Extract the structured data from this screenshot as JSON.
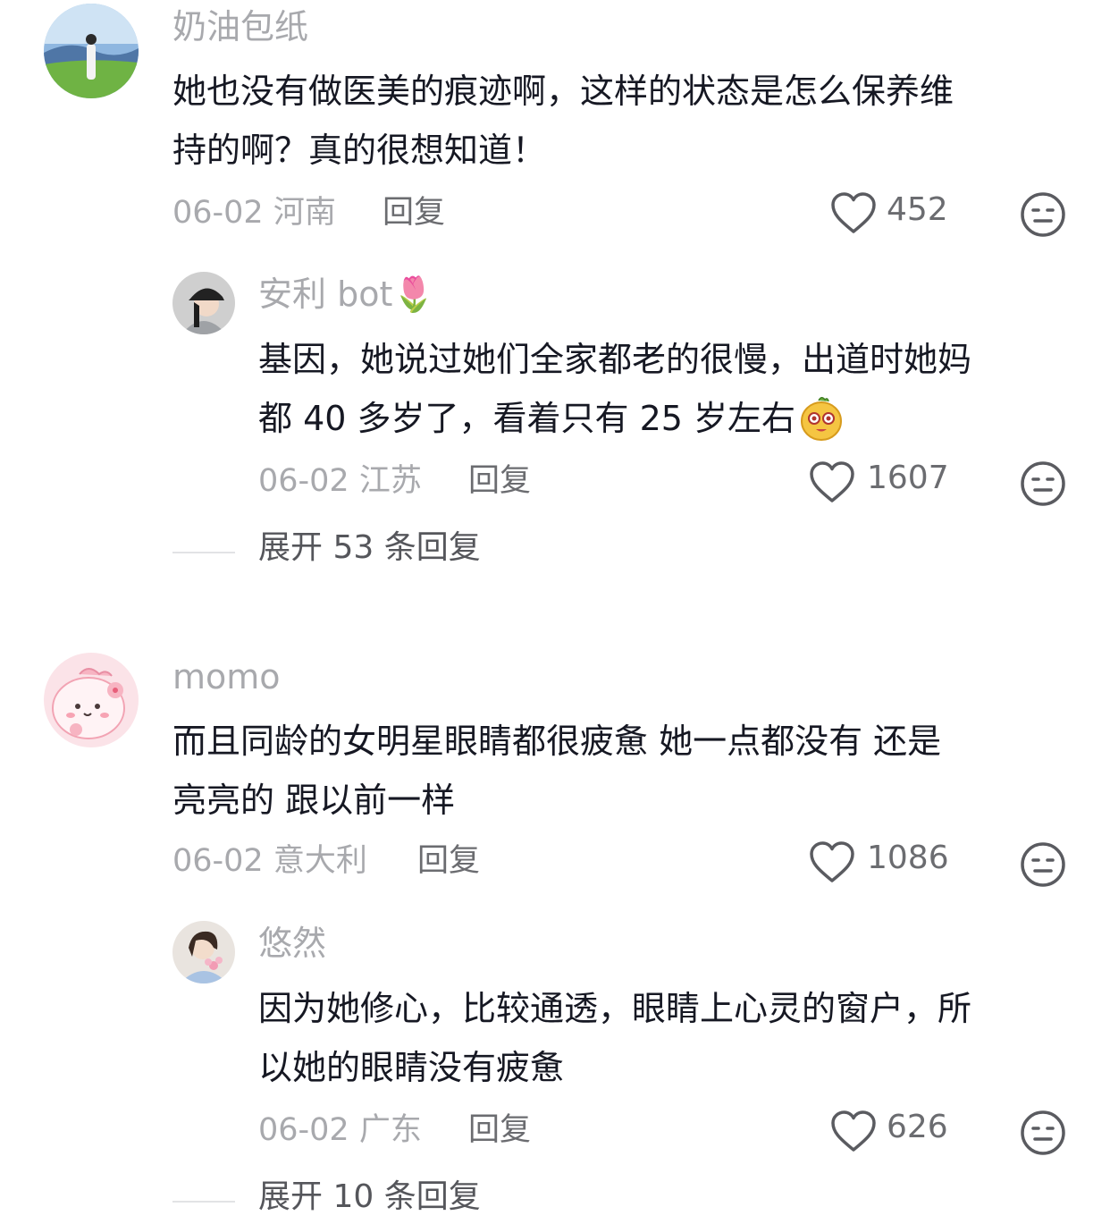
{
  "colors": {
    "muted": "#a8a9ad",
    "text": "#161823",
    "icon": "#5a5b60"
  },
  "comments": [
    {
      "username": "奶油包纸",
      "text_lines": [
        "她也没有做医美的痕迹啊，这样的状态是怎么保养维",
        "持的啊？真的很想知道！"
      ],
      "date": "06-02",
      "location": "河南",
      "reply_label": "回复",
      "likes": "452",
      "replies": [
        {
          "username": "安利 bot",
          "username_emoji": "🌷",
          "text_lines": [
            "基因，她说过她们全家都老的很慢，出道时她妈",
            "都 40 多岁了，看着只有 25 岁左右"
          ],
          "date": "06-02",
          "location": "江苏",
          "reply_label": "回复",
          "likes": "1607"
        }
      ],
      "expand_label": "展开 53 条回复"
    },
    {
      "username": "momo",
      "text_lines": [
        "而且同龄的女明星眼睛都很疲惫 她一点都没有 还是",
        "亮亮的 跟以前一样"
      ],
      "date": "06-02",
      "location": "意大利",
      "reply_label": "回复",
      "likes": "1086",
      "replies": [
        {
          "username": "悠然",
          "text_lines": [
            "因为她修心，比较通透，眼睛上心灵的窗户，所",
            "以她的眼睛没有疲惫"
          ],
          "date": "06-02",
          "location": "广东",
          "reply_label": "回复",
          "likes": "626"
        }
      ],
      "expand_label": "展开 10 条回复"
    }
  ]
}
